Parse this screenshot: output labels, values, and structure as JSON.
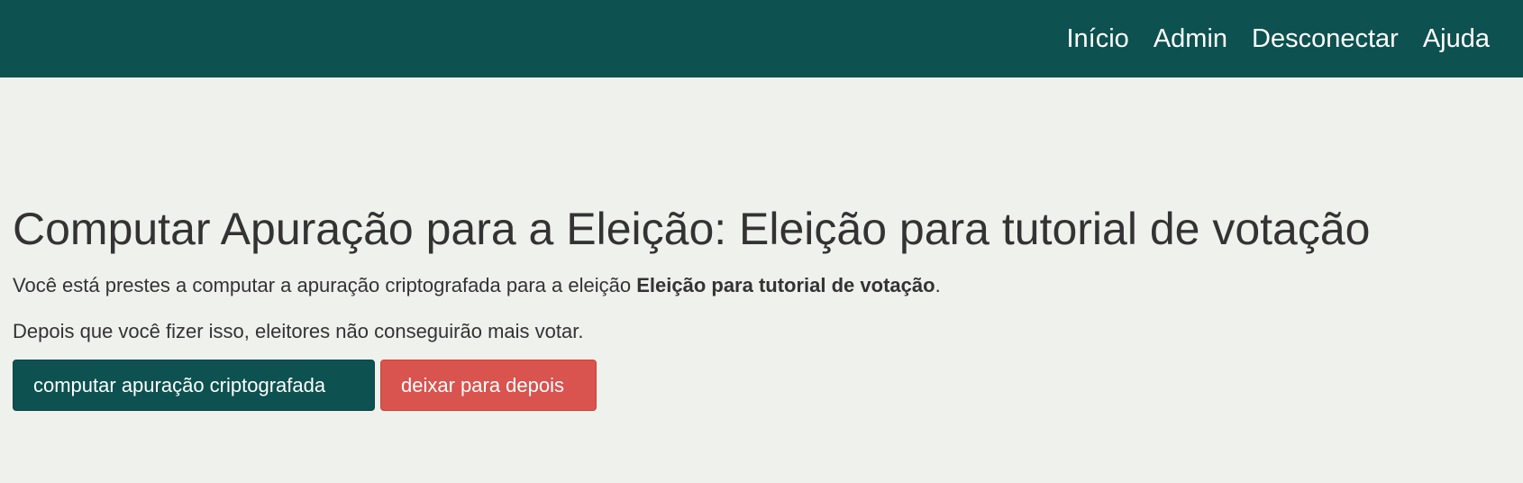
{
  "navbar": {
    "links": [
      {
        "label": "Início"
      },
      {
        "label": "Admin"
      },
      {
        "label": "Desconectar"
      },
      {
        "label": "Ajuda"
      }
    ]
  },
  "main": {
    "title": "Computar Apuração para a Eleição: Eleição para tutorial de votação",
    "intro_prefix": "Você está prestes a computar a apuração criptografada para a eleição ",
    "election_name": "Eleição para tutorial de votação",
    "intro_suffix": ".",
    "warning": "Depois que você fizer isso, eleitores não conseguirão mais votar.",
    "compute_button": "computar apuração criptografada",
    "later_button": "deixar para depois"
  },
  "colors": {
    "primary": "#0d5150",
    "danger": "#d9534f",
    "background": "#eff1ec",
    "text": "#333333"
  }
}
